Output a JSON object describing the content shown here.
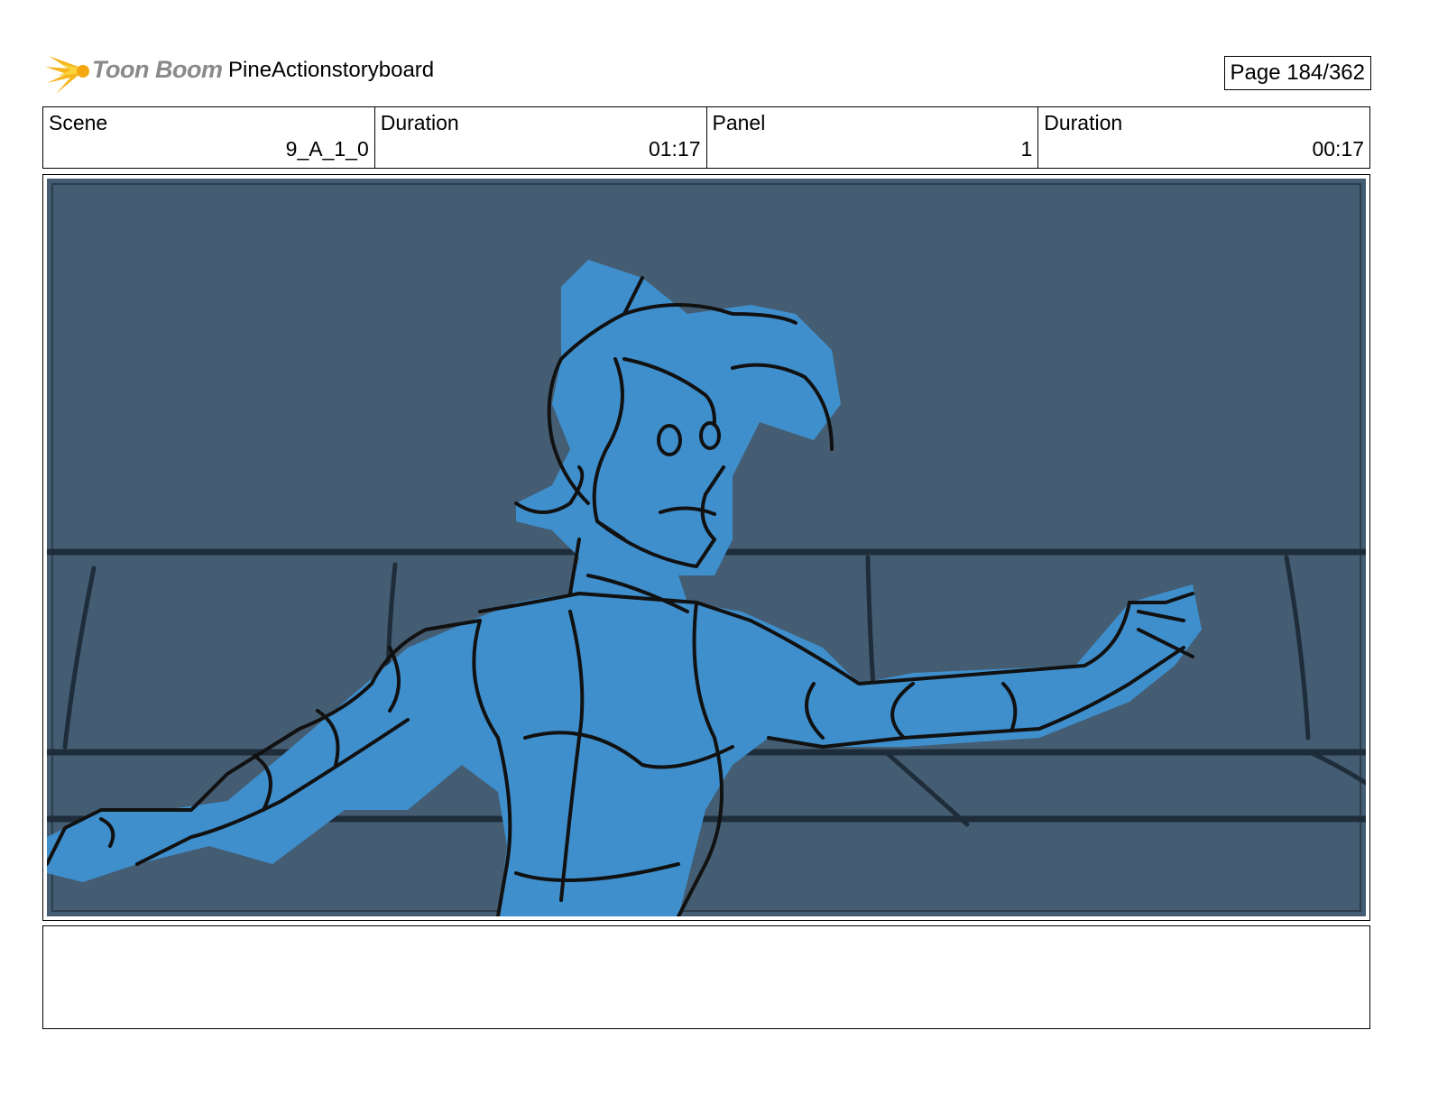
{
  "header": {
    "logo_text": "Toon Boom",
    "project_title": "PineActionstoryboard",
    "page_indicator": "Page 184/362"
  },
  "info": {
    "cells": [
      {
        "label": "Scene",
        "value": "9_A_1_0"
      },
      {
        "label": "Duration",
        "value": "01:17"
      },
      {
        "label": "Panel",
        "value": "1"
      },
      {
        "label": "Duration",
        "value": "00:17"
      }
    ]
  },
  "panel": {
    "icon": "storyboard-sketch",
    "colors": {
      "background": "#445d73",
      "figure_fill": "#3f8fcd",
      "line": "#111111",
      "bg_line": "#1f2d3a"
    }
  },
  "notes": {
    "text": ""
  }
}
